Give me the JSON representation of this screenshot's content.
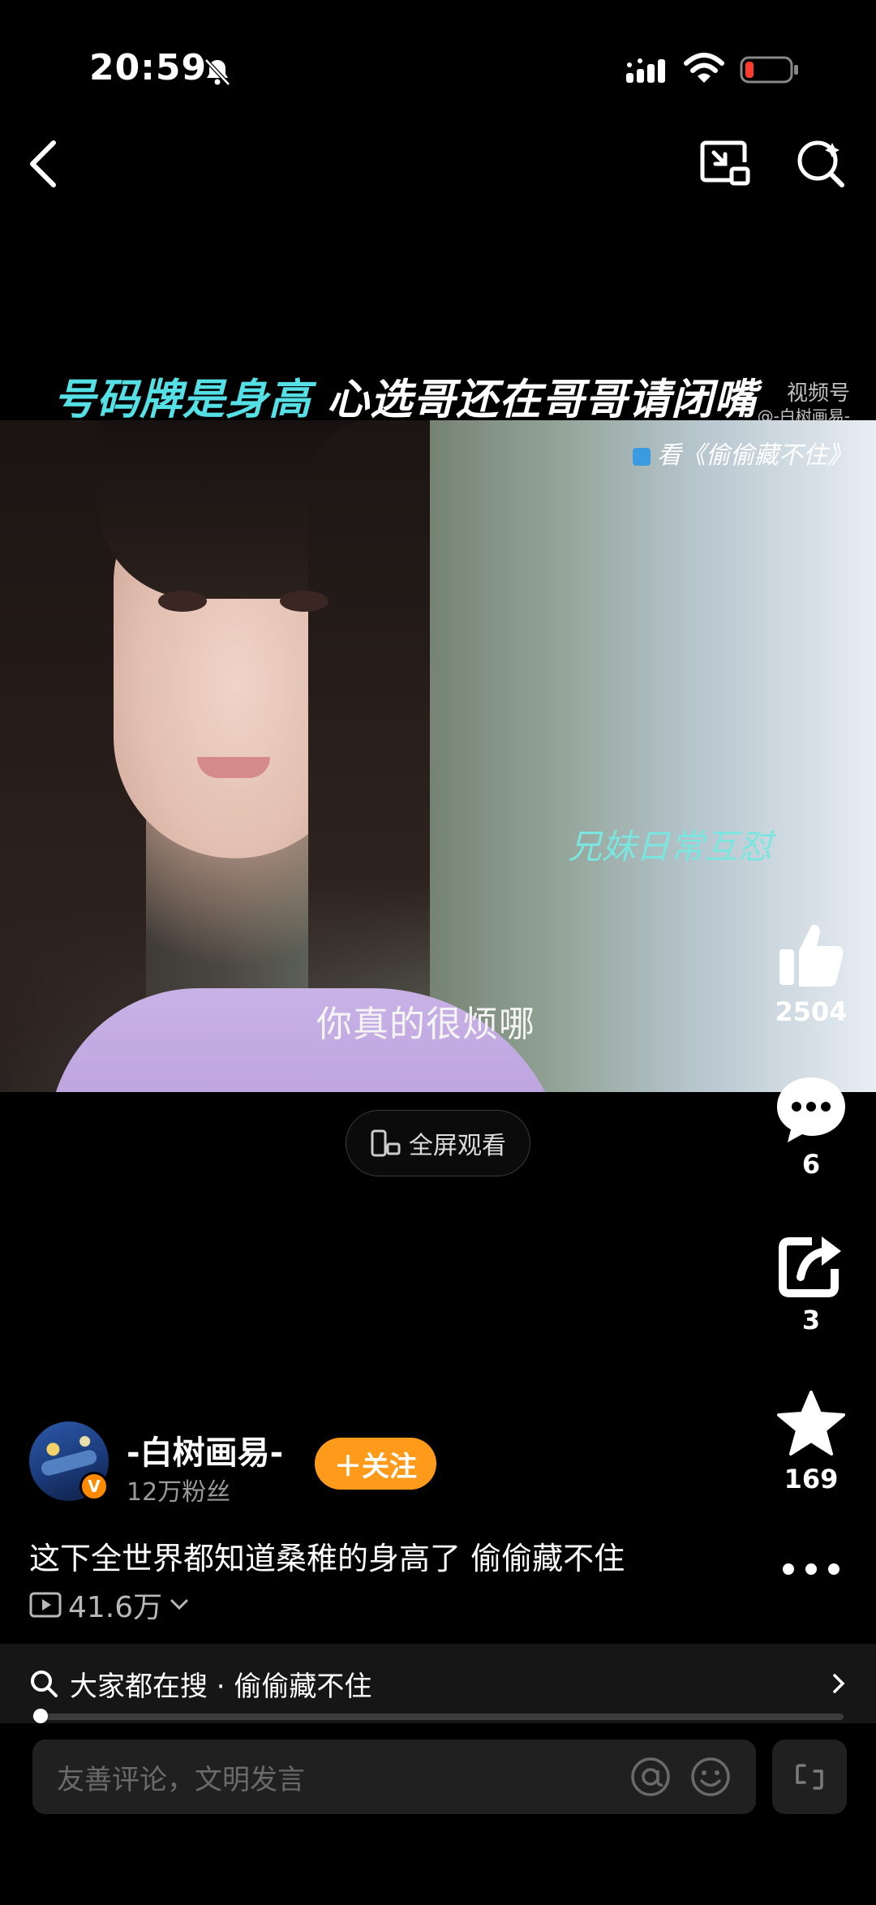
{
  "status_bar": {
    "time": "20:59"
  },
  "video": {
    "subtitle_top_cyan": "号码牌是身高",
    "subtitle_top_white": "心选哥还在哥哥请闭嘴",
    "watermark_line1": "视频号",
    "watermark_line2": "@-白树画易-",
    "watch_tag": "看《偷偷藏不住》",
    "caption_cyan": "兄妹日常互怼",
    "caption_white": "你真的很烦哪"
  },
  "fullscreen_label": "全屏观看",
  "rail": {
    "likes": "2504",
    "comments": "6",
    "shares": "3",
    "favorites": "169"
  },
  "author": {
    "name": "-白树画易-",
    "fans": "12万粉丝",
    "follow_label": "＋关注",
    "verified_badge": "V"
  },
  "description": "这下全世界都知道桑稚的身高了 偷偷藏不住",
  "plays": "41.6万",
  "search_suggest": "大家都在搜 · 偷偷藏不住",
  "comment_placeholder": "友善评论，文明发言",
  "progress_fraction": 0.01
}
